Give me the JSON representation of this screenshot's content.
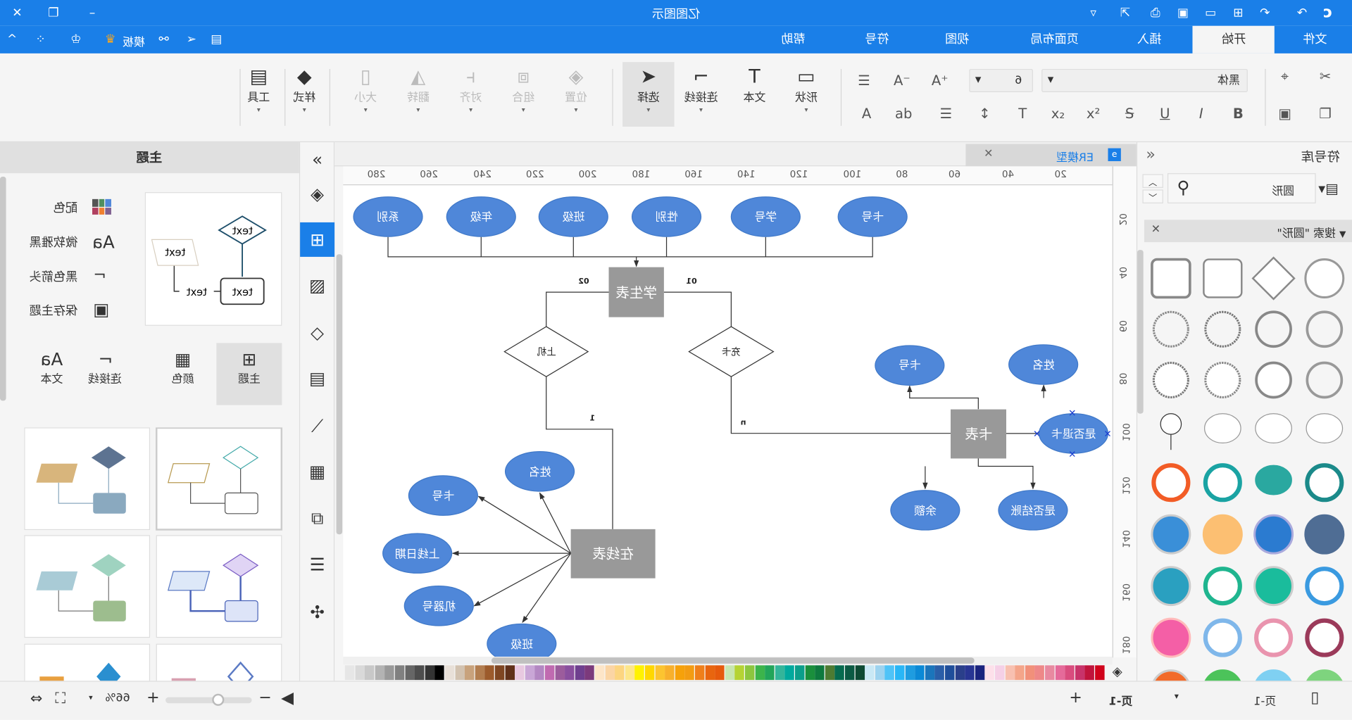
{
  "window": {
    "title": "亿图图示"
  },
  "ribbon": {
    "tabs": [
      "文件",
      "开始",
      "插入",
      "页面布局",
      "视图",
      "符号",
      "帮助"
    ],
    "active_tab": "开始",
    "template_label": "模板"
  },
  "toolbar": {
    "font_name": "黑体",
    "font_size": "6",
    "shape": "形状",
    "text": "文本",
    "connector": "连接线",
    "select": "选择",
    "position": "位置",
    "group": "组合",
    "align": "对齐",
    "flip": "翻转",
    "size": "大小",
    "style": "样式",
    "tools": "工具",
    "format_buttons": [
      "B",
      "I",
      "U",
      "S",
      "x²",
      "x₂",
      "T",
      "↕",
      "☰",
      "ab",
      "A"
    ]
  },
  "theme_panel": {
    "title": "主题",
    "options": [
      {
        "label": "配色",
        "icon": "color-grid-icon"
      },
      {
        "label": "微软雅黑",
        "icon": "font-icon"
      },
      {
        "label": "黑色箭头",
        "icon": "connector-icon"
      },
      {
        "label": "保存主题",
        "icon": "save-icon"
      }
    ],
    "preview_text": "text",
    "categories": [
      "主题",
      "颜色",
      "连接线",
      "文本"
    ],
    "active_category": "主题"
  },
  "side_icons": [
    "collapse-icon",
    "fill-icon",
    "theme-icon",
    "image-icon",
    "layers-icon",
    "document-icon",
    "chart-icon",
    "table-icon",
    "puzzle-icon",
    "gantt-icon",
    "mindmap-icon"
  ],
  "document_tab": {
    "label": "ER模型"
  },
  "ruler": {
    "h": [
      "280",
      "260",
      "240",
      "220",
      "200",
      "180",
      "160",
      "140",
      "120",
      "100",
      "80",
      "60",
      "40",
      "20"
    ],
    "v": [
      "20",
      "40",
      "60",
      "80",
      "100",
      "120",
      "140",
      "160",
      "180"
    ]
  },
  "diagram": {
    "student_table": "学生表",
    "student_attrs": [
      "系别",
      "年级",
      "班级",
      "性别",
      "学号",
      "卡号"
    ],
    "rel_use": "上机",
    "rel_charge": "充卡",
    "card_table": "卡表",
    "card_attrs": {
      "card_no": "卡号",
      "name": "姓名",
      "refund": "是否退卡",
      "balance": "余额",
      "settled": "是否结账"
    },
    "online_table": "在线表",
    "online_attrs": {
      "name": "姓名",
      "card_no": "卡号",
      "login_date": "上线日期",
      "machine": "机器号",
      "class": "班级"
    },
    "cardinality": {
      "c01": "01",
      "c02": "02",
      "one": "1",
      "n": "n"
    },
    "entity_color": "#999999",
    "attr_color": "#4f87d9"
  },
  "symbol_library": {
    "title": "符号库",
    "search_value": "圆形",
    "section": "搜索 \"圆形\""
  },
  "palette": [
    "#e6e6e6",
    "#d9d9d9",
    "#c8c8c8",
    "#b3b3b3",
    "#999999",
    "#808080",
    "#666666",
    "#4d4d4d",
    "#333333",
    "#000000",
    "#e8e0d8",
    "#d2c2b0",
    "#c8a27c",
    "#b27d4f",
    "#9c5b2c",
    "#7f4622",
    "#603019",
    "#e8c8e0",
    "#c9a6d6",
    "#b387c2",
    "#c06ab0",
    "#9c5c9c",
    "#8a4f9e",
    "#6f3f8f",
    "#7c3a7c",
    "#fde5c8",
    "#fbd5a5",
    "#fcd580",
    "#fde68a",
    "#fff200",
    "#ffd700",
    "#fcc430",
    "#f8b02c",
    "#f6a10a",
    "#f39c12",
    "#ef7f1a",
    "#e8650f",
    "#e65a0c",
    "#c8e6b0",
    "#b5d334",
    "#8cc63f",
    "#3cb44b",
    "#22a55a",
    "#33b59a",
    "#00a99d",
    "#0b9e8a",
    "#1a8f3c",
    "#0e7a3e",
    "#4d7b32",
    "#066b4f",
    "#0b5a43",
    "#0d4a33",
    "#c9e8f5",
    "#9dd3ef",
    "#4fc3f7",
    "#29b6f6",
    "#1e9ce0",
    "#0b89d6",
    "#1b75bb",
    "#2a5ea8",
    "#1f4e9a",
    "#2a3f8a",
    "#283593",
    "#1a237e",
    "#fde0ea",
    "#f5d0e6",
    "#f8c0b0",
    "#f4a58a",
    "#f1907a",
    "#ee8888",
    "#e889a0",
    "#e56a9a",
    "#d94c7e",
    "#c8336a",
    "#c0143c",
    "#d0021b"
  ],
  "status": {
    "zoom": "66%",
    "zoom_level": 66,
    "page_tab": "页-1",
    "page_label": "页-1"
  }
}
